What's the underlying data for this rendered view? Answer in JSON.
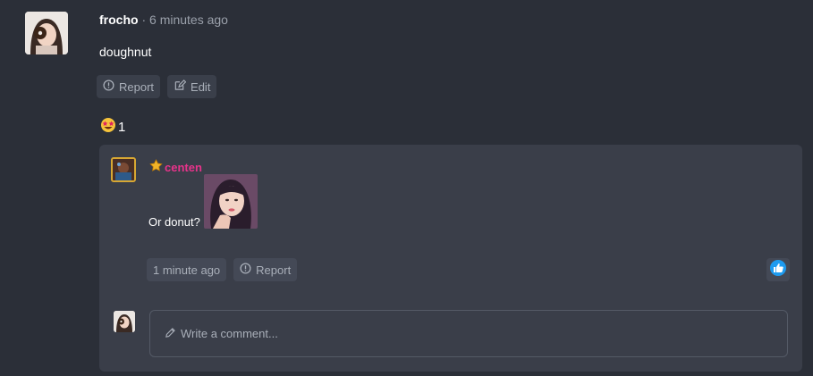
{
  "post": {
    "author": "frocho",
    "separator": " · ",
    "time": "6 minutes ago",
    "body": "doughnut",
    "actions": {
      "report": "Report",
      "edit": "Edit"
    },
    "reaction": {
      "icon": "star-struck-emoji",
      "count": "1"
    }
  },
  "reply": {
    "author": "centen",
    "text": "Or donut?",
    "time": "1 minute ago",
    "report": "Report",
    "like_icon": "thumbs-up-icon"
  },
  "comment_input": {
    "placeholder": "Write a comment..."
  },
  "colors": {
    "background": "#2b2f38",
    "panel": "#3a3e49",
    "accent_pink": "#e8338b",
    "like_blue": "#1d9bf0"
  }
}
